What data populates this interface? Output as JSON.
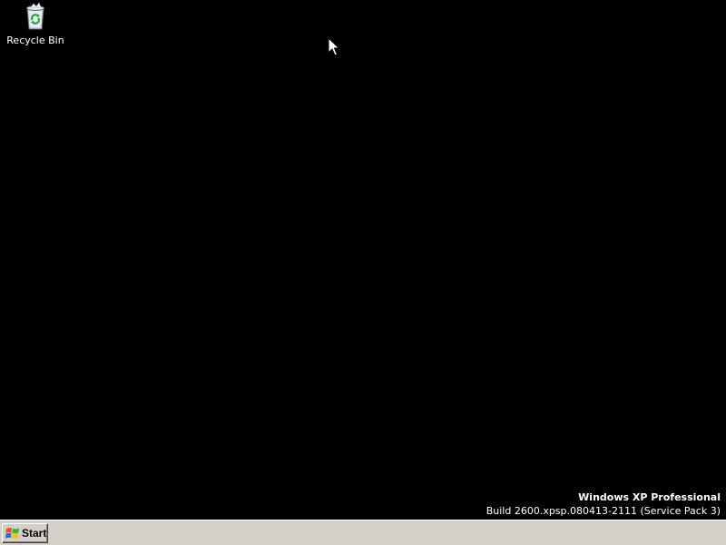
{
  "desktop": {
    "background_color": "#000000",
    "icons": [
      {
        "label": "Recycle Bin",
        "icon": "recycle-bin-icon"
      }
    ]
  },
  "version_info": {
    "edition": "Windows XP Professional",
    "build": "Build 2600.xpsp.080413-2111 (Service Pack 3)"
  },
  "taskbar": {
    "background_color": "#d4d0c8",
    "start_button": {
      "label": "Start",
      "icon": "windows-flag-icon"
    }
  },
  "cursor": {
    "icon": "arrow-cursor-icon"
  }
}
